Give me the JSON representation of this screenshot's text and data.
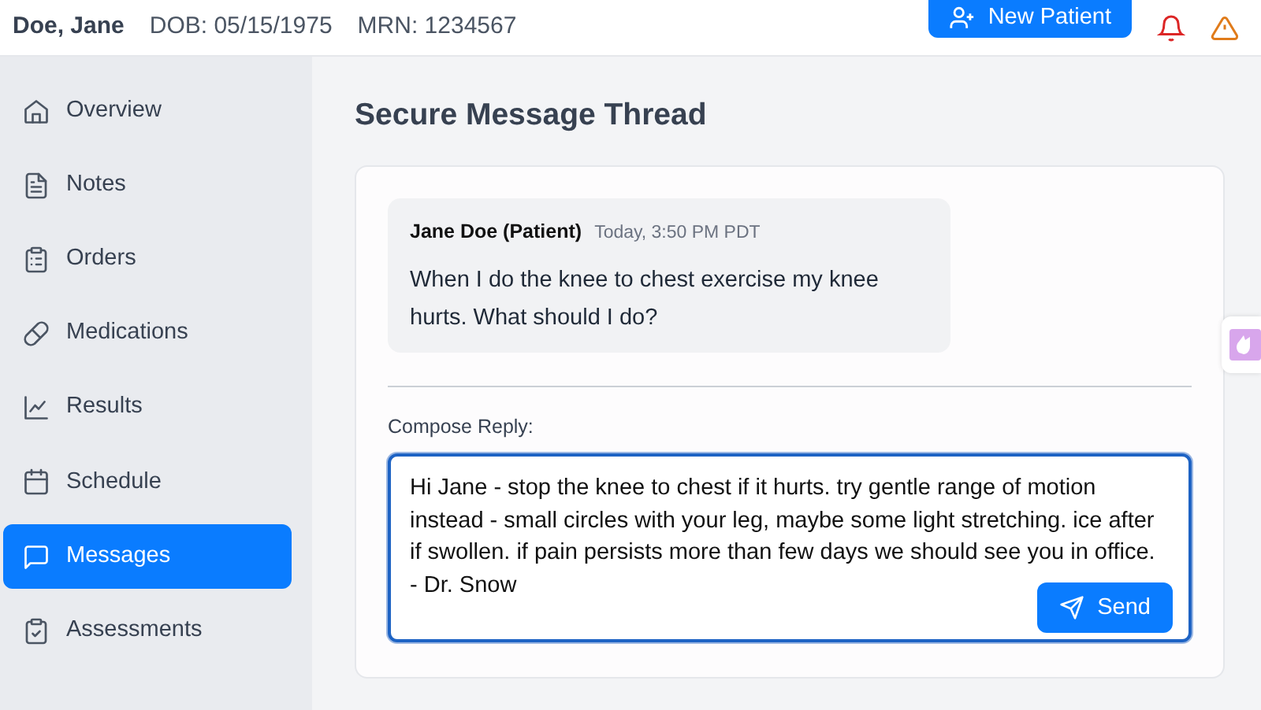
{
  "patient": {
    "name": "Doe, Jane",
    "dob": "DOB: 05/15/1975",
    "mrn": "MRN: 1234567"
  },
  "header_button": "New Patient",
  "sidebar": {
    "items": [
      {
        "label": "Overview",
        "selected": false
      },
      {
        "label": "Notes",
        "selected": false
      },
      {
        "label": "Orders",
        "selected": false
      },
      {
        "label": "Medications",
        "selected": false
      },
      {
        "label": "Results",
        "selected": false
      },
      {
        "label": "Schedule",
        "selected": false
      },
      {
        "label": "Messages",
        "selected": true
      },
      {
        "label": "Assessments",
        "selected": false
      }
    ]
  },
  "page_title": "Secure Message Thread",
  "messages": [
    {
      "sender": "Jane Doe (Patient)",
      "time": "Today, 3:50 PM PDT",
      "body": "When I do the knee to chest exercise my knee hurts. What should I do?"
    }
  ],
  "compose": {
    "label": "Compose Reply:",
    "value": "Hi Jane - stop the knee to chest if it hurts. try gentle range of motion instead - small circles with your leg, maybe some light stretching. ice after if swollen. if pain persists more than few days we should see you in office.\n- Dr. Snow",
    "button": "Send"
  }
}
